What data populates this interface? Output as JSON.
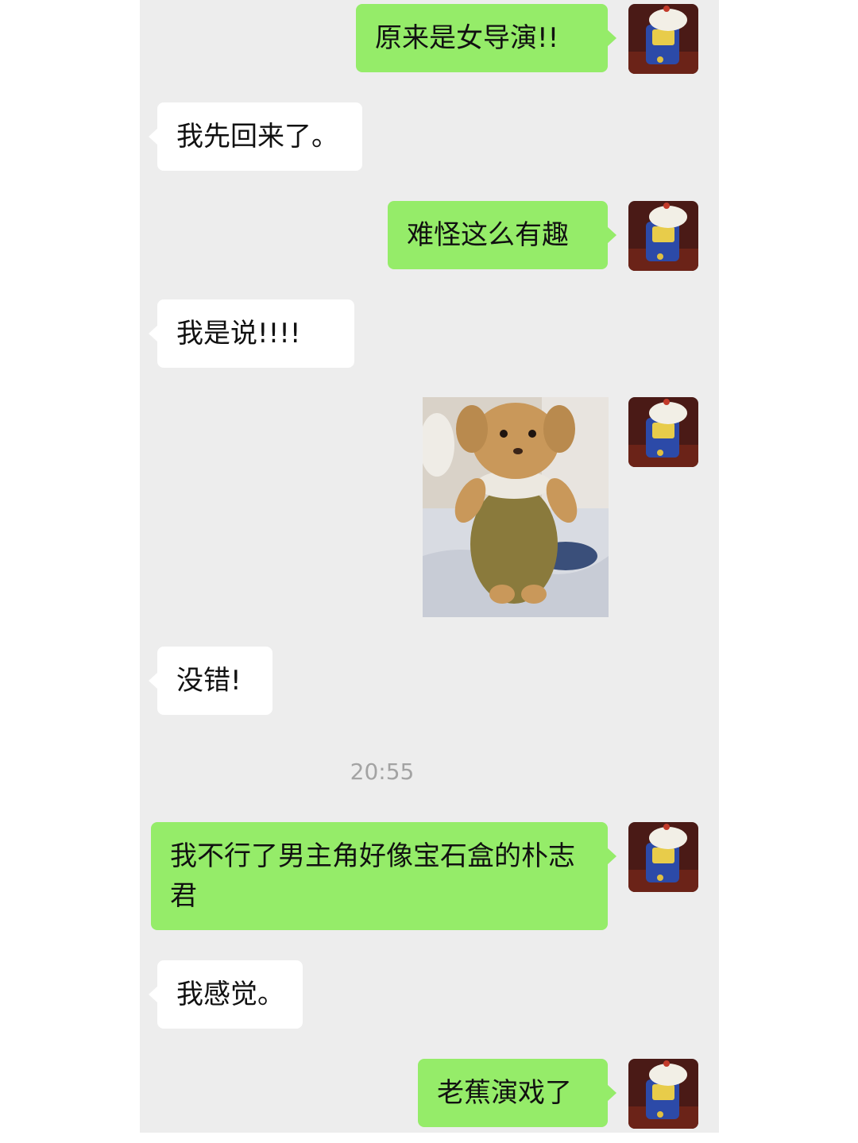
{
  "chat": {
    "messages": [
      {
        "from": "me",
        "text": "原来是女导演!!"
      },
      {
        "from": "them",
        "text": "我先回来了。"
      },
      {
        "from": "me",
        "text": "难怪这么有趣"
      },
      {
        "from": "them",
        "text": "我是说!!!!"
      },
      {
        "from": "me",
        "type": "sticker",
        "icon": "teddy-bear-sticker"
      },
      {
        "from": "them",
        "text": "没错!"
      },
      {
        "from": "me",
        "text": "我不行了男主角好像宝石盒的朴志君"
      },
      {
        "from": "them",
        "text": "我感觉。"
      },
      {
        "from": "me",
        "text": "老蕉演戏了"
      }
    ],
    "timestamp": "20:55"
  },
  "colors": {
    "outgoing_bubble": "#95ec69",
    "incoming_bubble": "#ffffff",
    "chat_background": "#ededed",
    "timestamp_text": "#a3a3a3"
  },
  "icons": {
    "avatar": "doll-avatar-icon"
  }
}
